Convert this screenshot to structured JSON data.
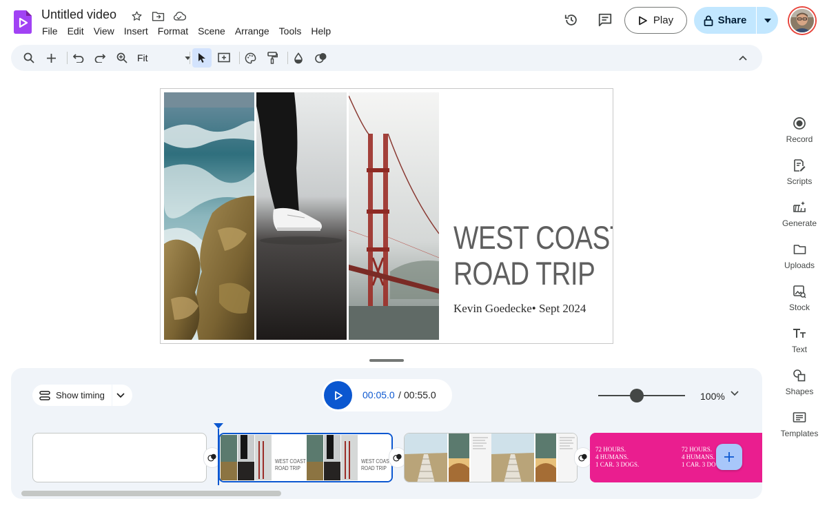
{
  "app": {
    "doc_title": "Untitled video",
    "menu": [
      "File",
      "Edit",
      "View",
      "Insert",
      "Format",
      "Scene",
      "Arrange",
      "Tools",
      "Help"
    ],
    "logo_color": "#a142f4",
    "accent": "#0b57d0"
  },
  "header": {
    "play_label": "Play",
    "share_label": "Share",
    "icons": [
      "star-icon",
      "move-to-folder-icon",
      "cloud-status-icon",
      "version-history-icon",
      "comments-icon",
      "lock-icon",
      "caret-down-icon"
    ]
  },
  "toolbar": {
    "zoom_value": "Fit",
    "tools": [
      "search-menus-icon",
      "add-icon",
      "undo-icon",
      "redo-icon",
      "zoom-icon",
      "select-icon",
      "text-box-icon",
      "paint-icon",
      "paint-format-icon",
      "fill-color-icon",
      "transition-icon",
      "collapse-icon"
    ]
  },
  "slide": {
    "title_line1": "WEST COAST",
    "title_line2": "ROAD TRIP",
    "subtitle": "Kevin Goedecke• Sept 2024"
  },
  "right_rail": {
    "items": [
      {
        "label": "Record",
        "icon": "record-icon"
      },
      {
        "label": "Scripts",
        "icon": "scripts-icon"
      },
      {
        "label": "Generate",
        "icon": "generate-icon"
      },
      {
        "label": "Uploads",
        "icon": "folder-icon"
      },
      {
        "label": "Stock",
        "icon": "stock-icon"
      },
      {
        "label": "Text",
        "icon": "text-icon"
      },
      {
        "label": "Shapes",
        "icon": "shapes-icon"
      },
      {
        "label": "Templates",
        "icon": "templates-icon"
      }
    ]
  },
  "timeline": {
    "show_timing_label": "Show timing",
    "current_time": "00:05.0",
    "time_separator": "/",
    "total_time": "00:55.0",
    "zoom_percent": "100%",
    "zoom_slider_fraction": 0.43,
    "scenes": [
      {
        "name": "blank"
      },
      {
        "name": "title",
        "title_line1": "WEST COAST",
        "title_line2": "ROAD TRIP",
        "selected": true
      },
      {
        "name": "boardwalk"
      },
      {
        "name": "pink",
        "line1": "72 HOURS.",
        "line2": "4 HUMANS.",
        "line3": "1 CAR. 3 DOGS.",
        "line1b": "72 HOURS.",
        "line2b": "4 HUMANS.",
        "line3b": "1 CAR. 3 DO"
      }
    ]
  }
}
